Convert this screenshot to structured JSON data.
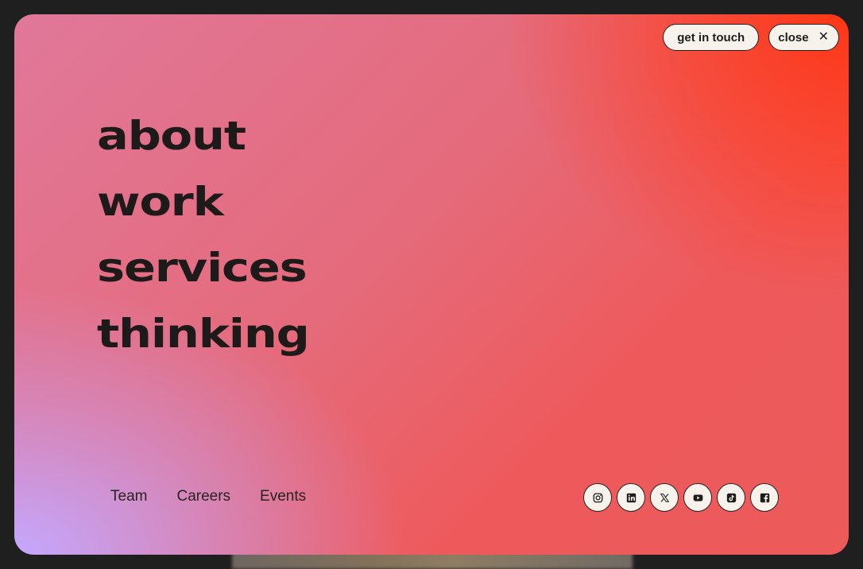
{
  "header": {
    "get_in_touch_label": "get in touch",
    "close_label": "close"
  },
  "main_nav": {
    "items": [
      {
        "label": "about"
      },
      {
        "label": "work"
      },
      {
        "label": "services"
      },
      {
        "label": "thinking"
      }
    ]
  },
  "secondary_nav": {
    "items": [
      {
        "label": "Team"
      },
      {
        "label": "Careers"
      },
      {
        "label": "Events"
      }
    ]
  },
  "social": {
    "icons": [
      "instagram-icon",
      "linkedin-icon",
      "x-icon",
      "youtube-icon",
      "tiktok-icon",
      "facebook-icon"
    ]
  },
  "colors": {
    "gradient_top_right": "#ff3a14",
    "gradient_center": "#e56a7a",
    "gradient_bottom_left": "#c4a8ff",
    "pill_background": "#f7f2ec",
    "text_dark": "#1f1a1a",
    "page_background": "#1f1f1f"
  }
}
